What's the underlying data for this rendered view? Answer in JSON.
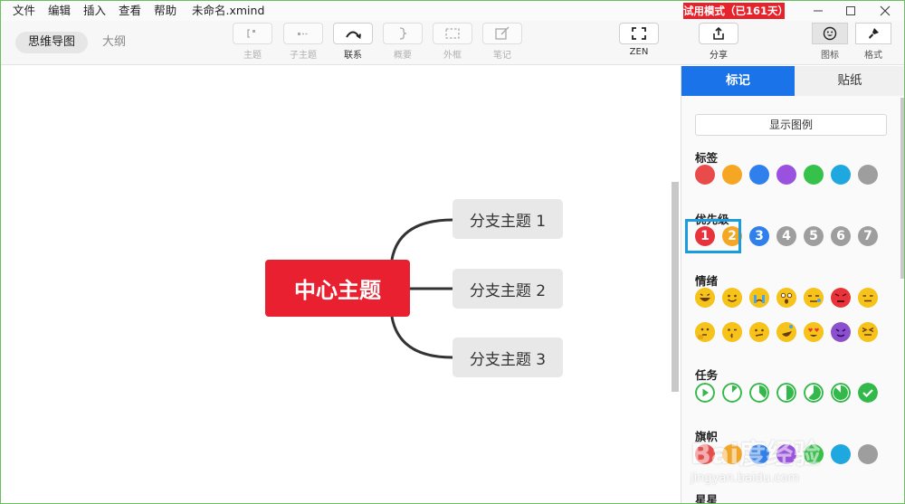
{
  "menu": [
    "文件",
    "编辑",
    "插入",
    "查看",
    "帮助"
  ],
  "filename": "未命名.xmind",
  "trial_badge": "试用模式（已161天）",
  "view_tabs": {
    "mindmap": "思维导图",
    "outline": "大纲"
  },
  "tools": {
    "topic": "主题",
    "subtopic": "子主题",
    "relationship": "联系",
    "summary": "概要",
    "boundary": "外框",
    "note": "笔记",
    "zen": "ZEN",
    "share": "分享",
    "icons": "图标",
    "format": "格式"
  },
  "map": {
    "central": "中心主题",
    "branches": [
      "分支主题 1",
      "分支主题 2",
      "分支主题 3"
    ],
    "line_color": "#333333",
    "central_color": "#e8202f"
  },
  "panel": {
    "tabs": {
      "markers": "标记",
      "stickers": "贴纸"
    },
    "show_legend": "显示图例",
    "sections": {
      "tags": "标签",
      "priority": "优先级",
      "mood": "情绪",
      "task": "任务",
      "flag": "旗帜",
      "star": "星星"
    },
    "tag_colors": [
      "#e94b4b",
      "#f5a623",
      "#2f80ed",
      "#9b51e0",
      "#36c24a",
      "#1fa7e0",
      "#9e9e9e"
    ],
    "priority": [
      {
        "n": "1",
        "color": "#e8323c"
      },
      {
        "n": "2",
        "color": "#f5a623"
      },
      {
        "n": "3",
        "color": "#2f80ed"
      },
      {
        "n": "4",
        "color": "#9e9e9e"
      },
      {
        "n": "5",
        "color": "#9e9e9e"
      },
      {
        "n": "6",
        "color": "#9e9e9e"
      },
      {
        "n": "7",
        "color": "#9e9e9e"
      }
    ],
    "task_progress": [
      0,
      0.125,
      0.375,
      0.5,
      0.625,
      0.875,
      1
    ],
    "flag_colors": [
      "#e94b4b",
      "#f5a623",
      "#2f80ed",
      "#9b51e0",
      "#36c24a",
      "#1fa7e0",
      "#9e9e9e"
    ]
  },
  "watermark": {
    "brand": "Bai度经验",
    "url": "jingyan.baidu.com"
  }
}
